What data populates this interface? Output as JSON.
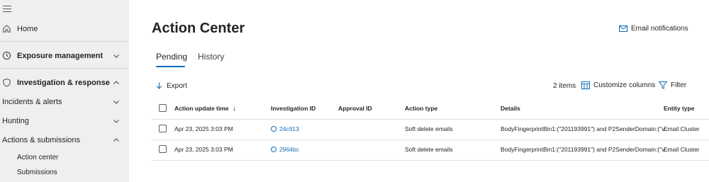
{
  "sidebar": {
    "items": [
      {
        "label": "Home",
        "icon": "home-icon"
      },
      {
        "label": "Exposure management",
        "icon": "clock-icon",
        "expanded": false
      },
      {
        "label": "Investigation & response",
        "icon": "shield-icon",
        "expanded": true
      },
      {
        "label": "Incidents & alerts",
        "expanded": false
      },
      {
        "label": "Hunting",
        "expanded": false
      },
      {
        "label": "Actions & submissions",
        "expanded": true
      }
    ],
    "subitems": [
      {
        "label": "Action center"
      },
      {
        "label": "Submissions"
      }
    ]
  },
  "header": {
    "title": "Action Center",
    "email_notifications": "Email notifications"
  },
  "tabs": [
    {
      "label": "Pending",
      "active": true
    },
    {
      "label": "History",
      "active": false
    }
  ],
  "toolbar": {
    "export": "Export",
    "items_count": "2 items",
    "customize_columns": "Customize columns",
    "filter": "Filter"
  },
  "table": {
    "columns": [
      "Action update time",
      "Investigation ID",
      "Approval ID",
      "Action type",
      "Details",
      "Entity type"
    ],
    "sort_indicator": "↓",
    "rows": [
      {
        "time": "Apr 23, 2025 3:03 PM",
        "investigation_id": "24c913",
        "approval_id": "",
        "action_type": "Soft delete emails",
        "details": "BodyFingerprintBin1:(\"201193991\") and P2SenderDomain:(\"v...",
        "entity_type": "Email Cluster"
      },
      {
        "time": "Apr 23, 2025 3:03 PM",
        "investigation_id": "2964bc",
        "approval_id": "",
        "action_type": "Soft delete emails",
        "details": "BodyFingerprintBin1:(\"201193991\") and P2SenderDomain:(\"v...",
        "entity_type": "Email Cluster"
      }
    ]
  },
  "colors": {
    "accent": "#0f6cbd",
    "sidebar_bg": "#efefef",
    "text": "#242424"
  }
}
